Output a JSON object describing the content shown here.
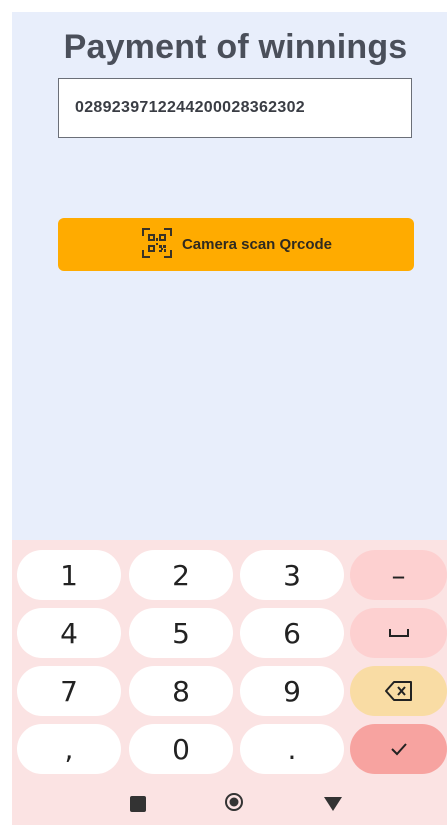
{
  "screen": {
    "title": "Payment of winnings",
    "code_value": "02892397122442000283623​02",
    "scan_button_label": "Camera scan Qrcode",
    "qr_icon": "qr-code-icon"
  },
  "keyboard": {
    "rows": [
      [
        "1",
        "2",
        "3",
        "–"
      ],
      [
        "4",
        "5",
        "6",
        "␣"
      ],
      [
        "7",
        "8",
        "9",
        "⌫"
      ],
      [
        ",",
        "0",
        ".",
        "✓"
      ]
    ]
  },
  "navigation": {
    "recents_icon": "square-icon",
    "home_icon": "circle-icon",
    "back_icon": "triangle-down-icon"
  },
  "colors": {
    "app_background": "#e8eefb",
    "accent_button": "#ffab00",
    "keyboard_background": "#fbe3e3",
    "key_fn": "#fdd0d0",
    "key_backspace": "#f9dca4",
    "key_enter": "#f7a3a0"
  }
}
